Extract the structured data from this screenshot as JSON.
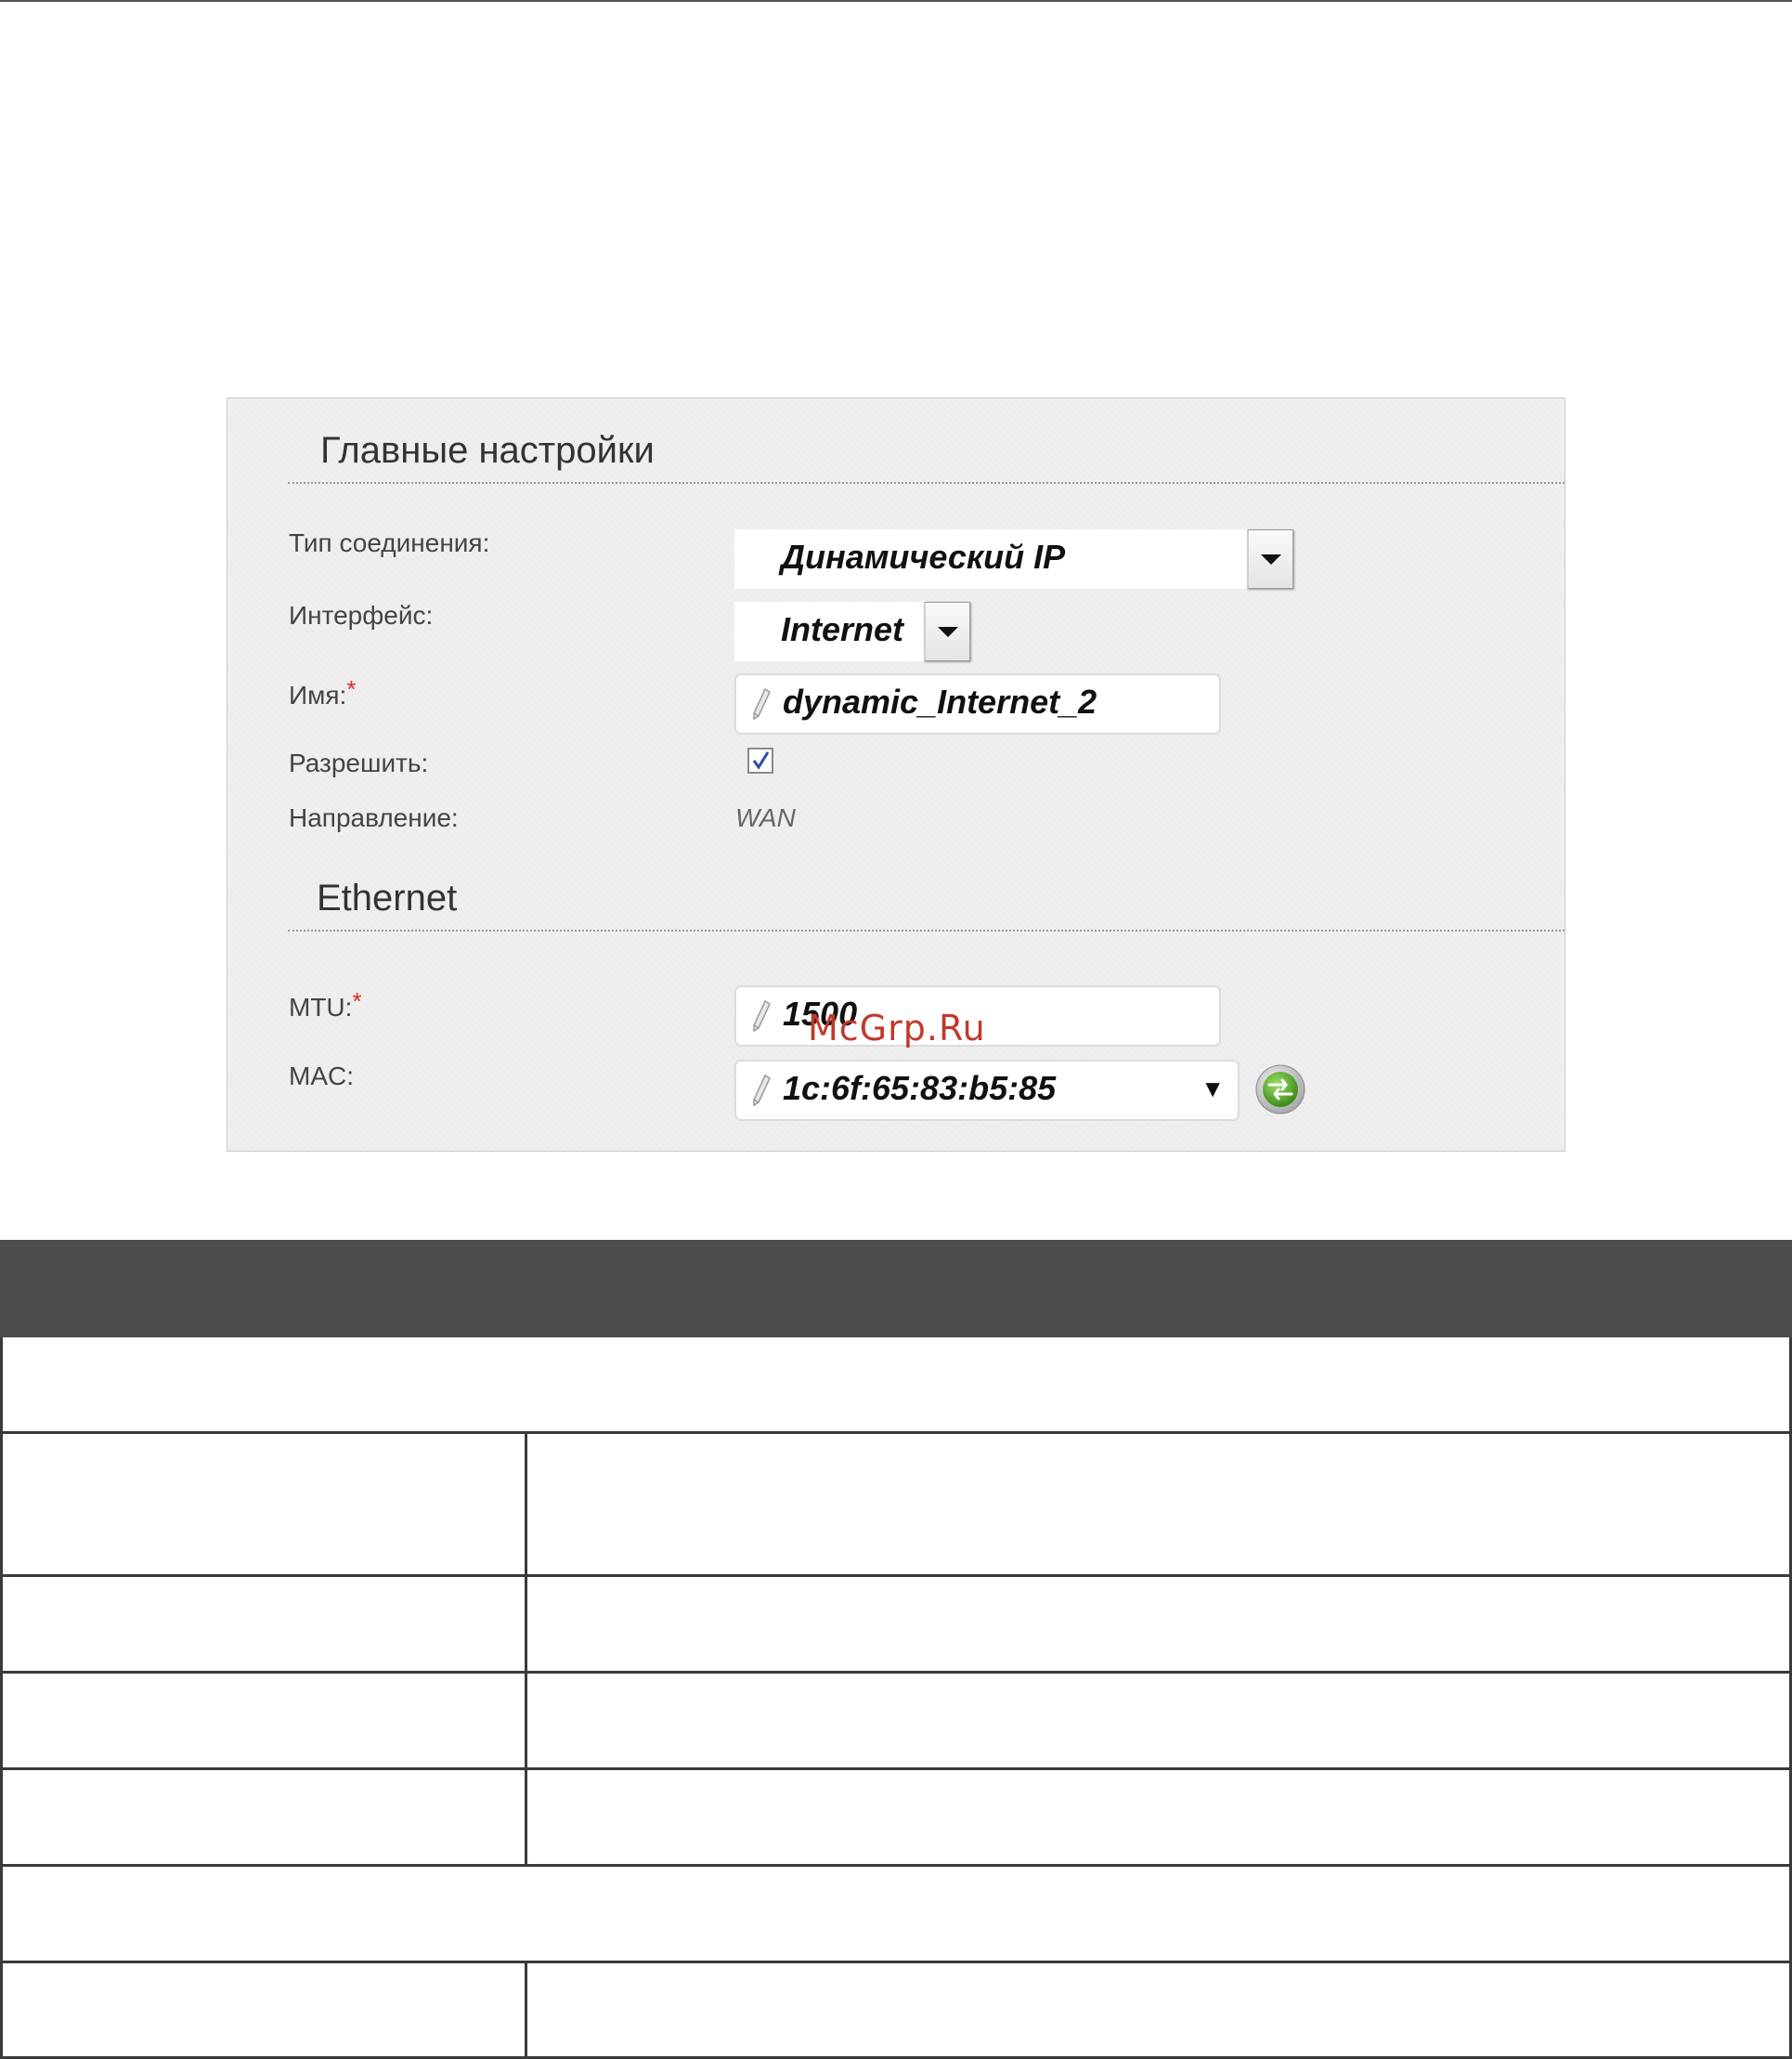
{
  "sections": {
    "main": {
      "title": "Главные настройки"
    },
    "ethernet": {
      "title": "Ethernet"
    }
  },
  "fields": {
    "connection_type": {
      "label": "Тип соединения:",
      "value": "Динамический IP"
    },
    "interface": {
      "label": "Интерфейс:",
      "value": "Internet"
    },
    "name": {
      "label": "Имя:",
      "required_mark": "*",
      "value": "dynamic_Internet_2"
    },
    "enable": {
      "label": "Разрешить:",
      "checked": true
    },
    "direction": {
      "label": "Направление:",
      "value": "WAN"
    },
    "mtu": {
      "label": "MTU:",
      "required_mark": "*",
      "value": "1500"
    },
    "mac": {
      "label": "MAC:",
      "value": "1c:6f:65:83:b5:85"
    }
  },
  "icons": {
    "dropdown": "chevron-down-icon",
    "edit": "pencil-icon",
    "clone_mac": "refresh-arrows-icon",
    "checkbox": "checkmark-icon"
  },
  "watermark": "McGrp.Ru",
  "colors": {
    "panel_bg": "#efefef",
    "required": "#e0262b",
    "table_header": "#4c4c4c",
    "refresh_button": "#5aa82a"
  }
}
